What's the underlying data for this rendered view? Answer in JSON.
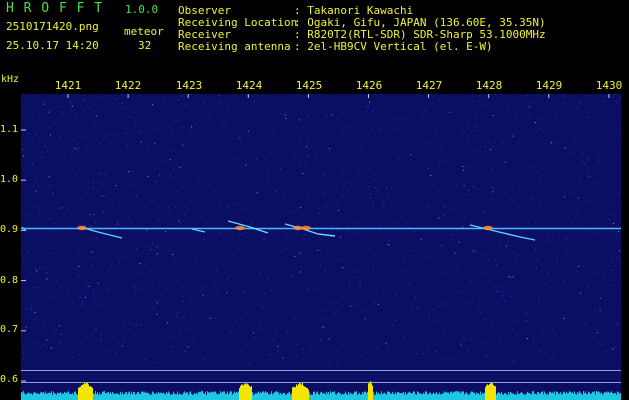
{
  "app": {
    "name_letters": "H R O F F T",
    "version": "1.0.0",
    "filename": "2510171420.png",
    "datetime": "25.10.17 14:20",
    "meteor_label": "meteor",
    "meteor_count": "32"
  },
  "info": {
    "rows": [
      {
        "label": "Observer",
        "value": ": Takanori Kawachi"
      },
      {
        "label": "Receiving Location",
        "value": ": Ogaki, Gifu, JAPAN (136.60E, 35.35N)"
      },
      {
        "label": "Receiver",
        "value": ": R820T2(RTL-SDR) SDR-Sharp 53.1000MHz"
      },
      {
        "label": "Receiving antenna",
        "value": ": 2el-HB9CV Vertical (el. E-W)"
      }
    ]
  },
  "axes": {
    "y_unit": "kHz",
    "x_ticks": [
      "1421",
      "1422",
      "1423",
      "1424",
      "1425",
      "1426",
      "1427",
      "1428",
      "1429",
      "1430"
    ],
    "y_ticks": [
      "1.1",
      "1.0",
      "0.9",
      "0.8",
      "0.7",
      "0.6"
    ]
  },
  "colors": {
    "background": "#0a0f64",
    "header_text": "#f2f23a",
    "title_text": "#46e046",
    "signal_line": "#4fb4ff",
    "level_bars": "#1ec8e0",
    "level_peaks": "#f2e600"
  }
}
